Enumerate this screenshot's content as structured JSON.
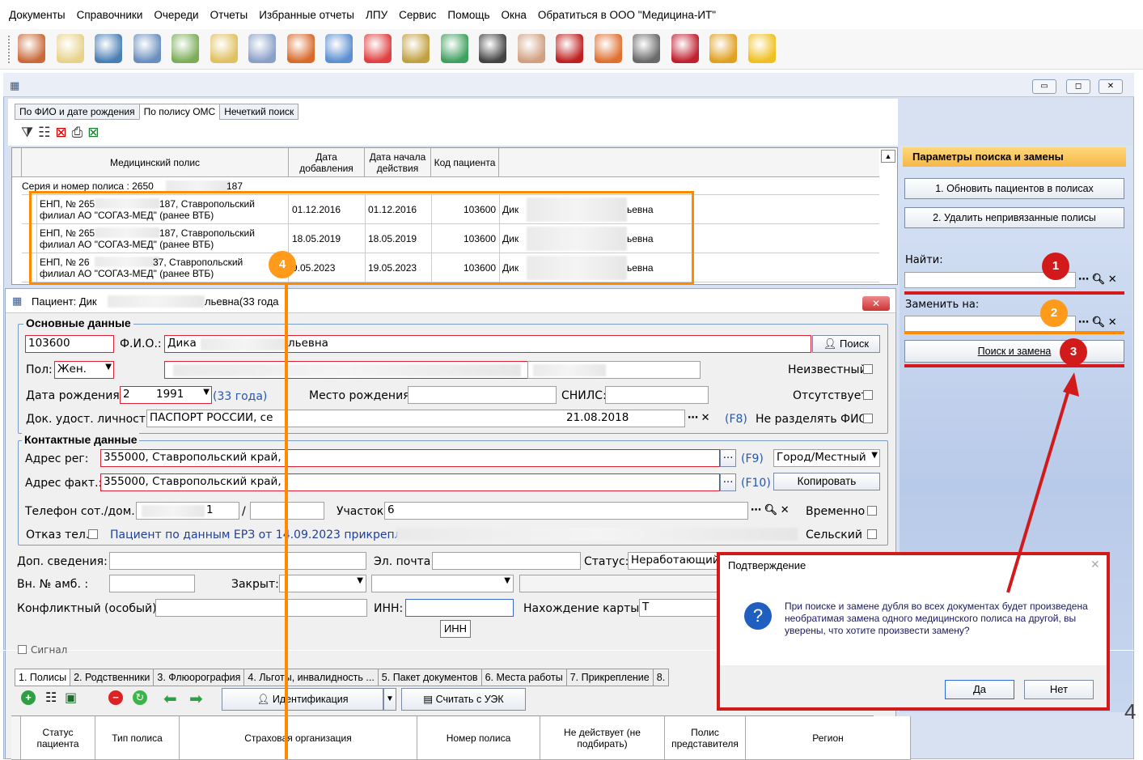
{
  "menu": [
    "Документы",
    "Справочники",
    "Очереди",
    "Отчеты",
    "Избранные отчеты",
    "ЛПУ",
    "Сервис",
    "Помощь",
    "Окна",
    "Обратиться в ООО \"Медицина-ИТ\""
  ],
  "toolbar_icons": [
    "patient-icon",
    "calendar-icon",
    "card-icon",
    "id-card-icon",
    "flask-icon",
    "edit-icon",
    "syringe-icon",
    "folder-icon",
    "search-doc-icon",
    "first-aid-icon",
    "pills-icon",
    "chart-icon",
    "hammer-icon",
    "doctor-icon",
    "book-icon",
    "monitor-icon",
    "catalog-icon",
    "pdf-icon",
    "lock-icon",
    "chat-icon"
  ],
  "search_tabs": [
    "По ФИО и дате рождения",
    "По полису ОМС",
    "Нечеткий поиск"
  ],
  "policy_grid": {
    "headers": [
      "Медицинский полис",
      "Дата добавления",
      "Дата начала действия",
      "Код пациента"
    ],
    "group_row": "Серия и номер полиса :  2650",
    "group_suffix": "187",
    "rows": [
      {
        "policy1": "ЕНП, № 265",
        "policy1b": "187, Ставропольский",
        "policy2": "филиал АО \"СОГАЗ-МЕД\" (ранее ВТБ)",
        "added": "01.12.2016",
        "start": "01.12.2016",
        "code": "103600",
        "name": "Дик",
        "name_end": "ьевна"
      },
      {
        "policy1": "ЕНП, № 265",
        "policy1b": "187, Ставропольский",
        "policy2": "филиал АО \"СОГАЗ-МЕД\" (ранее ВТБ)",
        "added": "18.05.2019",
        "start": "18.05.2019",
        "code": "103600",
        "name": "Дик",
        "name_end": "ьевна"
      },
      {
        "policy1": "ЕНП, № 26",
        "policy1b": "37, Ставропольский",
        "policy2": "филиал АО \"СОГАЗ-МЕД\" (ранее ВТБ)",
        "added": "9.05.2023",
        "start": "19.05.2023",
        "code": "103600",
        "name": "Дик",
        "name_end": "ьевна"
      }
    ]
  },
  "right_panel": {
    "title": "Параметры поиска и замены",
    "btn1": "1. Обновить пациентов в полисах",
    "btn2": "2. Удалить непривязанные полисы",
    "find_label": "Найти:",
    "replace_label": "Заменить на:",
    "search_replace": "Поиск и замена"
  },
  "badges": [
    "1",
    "2",
    "3",
    "4"
  ],
  "patient": {
    "title": "Пациент: Дик",
    "title_end": "льевна(33 года",
    "main_group": "Основные данные",
    "code": "103600",
    "fio_label": "Ф.И.О.:",
    "fio": "Дика",
    "fio_end": "льевна",
    "search_btn": "Поиск",
    "sex_label": "Пол:",
    "sex": "Жен.",
    "unknown": "Неизвестный",
    "dob_label": "Дата рождения:",
    "dob_day": "2",
    "dob_year": "1991",
    "age": "(33 года)",
    "birthplace_label": "Место рождения:",
    "snils_label": "СНИЛС:",
    "absent": "Отсутствует",
    "doc_label": "Док. удост. личность:",
    "doc_value": "ПАСПОРТ РОССИИ, се",
    "doc_date": "21.08.2018",
    "f8": "(F8)",
    "no_split": "Не разделять ФИО",
    "contact_group": "Контактные данные",
    "addr_reg_label": "Адрес рег:",
    "addr_reg": "355000, Ставропольский край,",
    "f9": "(F9)",
    "addr_type": "Город/Местный",
    "addr_fact_label": "Адрес факт.:",
    "addr_fact": "355000, Ставропольский край,",
    "f10": "(F10)",
    "copy_btn": "Копировать",
    "phone_label": "Телефон сот./дом.:",
    "phone_end": "1",
    "slash": "/",
    "section_label": "Участок:",
    "section": "6",
    "temp": "Временно",
    "refuse_label": "Отказ тел.",
    "erz": "Пациент по данным ЕРЗ от 14.09.2023 прикреплен",
    "rural": "Сельский",
    "extra_label": "Доп. сведения:",
    "email_label": "Эл. почта:",
    "status_label": "Статус:",
    "status": "Неработающий;",
    "amb_label": "Вн. № амб. :",
    "closed_label": "Закрыт:",
    "conflict_label": "Конфликтный (особый):",
    "inn_label": "ИНН:",
    "card_label": "Нахождение карты:",
    "card_value": "Т",
    "inn_tooltip": "ИНН",
    "signal": "Сигнал"
  },
  "bottom_tabs": [
    "1. Полисы",
    "2. Родственники",
    "3. Флюорография",
    "4. Льготы, инвалидность ...",
    "5. Пакет документов",
    "6. Места работы",
    "7. Прикрепление",
    "8."
  ],
  "policy_toolbar": {
    "ident": "Идентификация",
    "read_uek": "Считать с УЭК"
  },
  "policy_headers": [
    "Статус пациента",
    "Тип полиса",
    "Страховая организация",
    "Номер полиса",
    "Не действует (не подбирать)",
    "Полис представителя",
    "Регион"
  ],
  "dialog": {
    "title": "Подтверждение",
    "message": "При поиске и замене дубля во всех документах будет произведена необратимая замена одного медицинского полиса на другой, вы уверены, что хотите произвести замену?",
    "yes": "Да",
    "no": "Нет"
  },
  "edge_digit": "4"
}
